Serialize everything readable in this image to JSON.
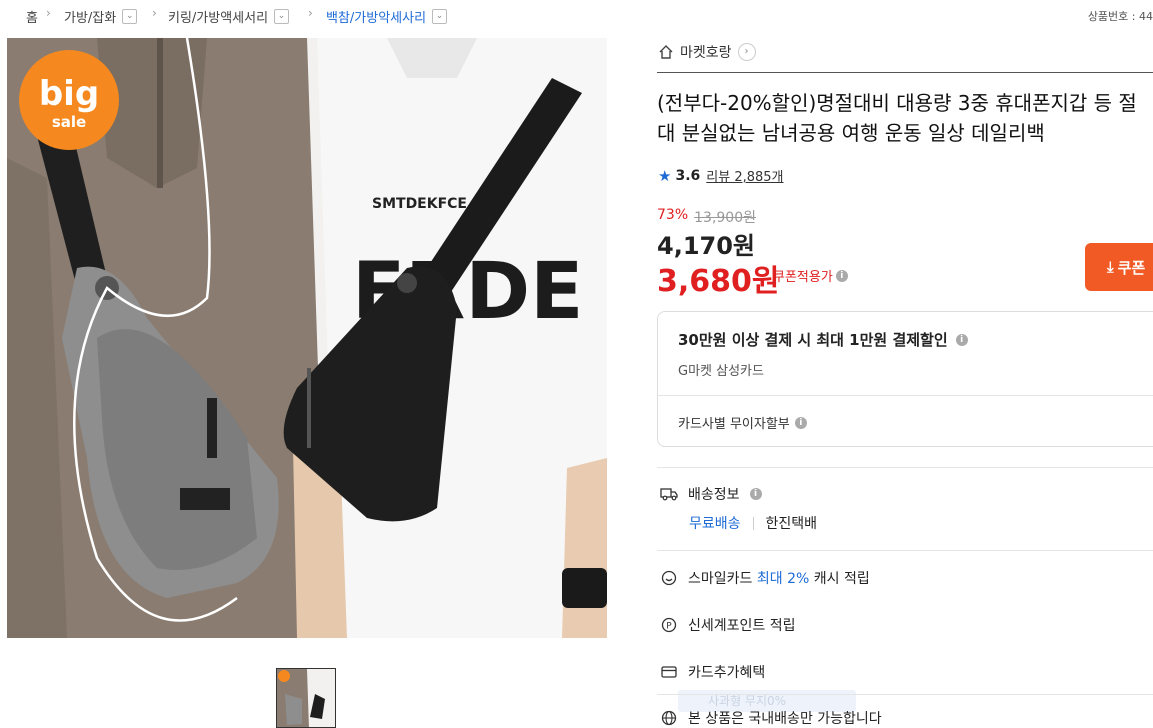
{
  "breadcrumb": {
    "home": "홈",
    "items": [
      "가방/잡화",
      "키링/가방액세서리",
      "백참/가방악세사리"
    ]
  },
  "product_no_label": "상품번호 : 44",
  "seller": {
    "name": "마켓호랑"
  },
  "badge": {
    "line1": "big",
    "line2": "sale"
  },
  "product": {
    "title": "(전부다-20%할인)명절대비 대용량 3중 휴대폰지갑 등 절대 분실없는 남녀공용 여행 운동 일상 데일리백",
    "rating": "3.6",
    "review_text": "리뷰 2,885개",
    "discount_rate": "73%",
    "original_price": "13,900원",
    "price": "4,170원",
    "coupon_price": "3,680원",
    "coupon_price_label": "쿠폰적용가"
  },
  "coupon_button": {
    "label": "쿠폰"
  },
  "card_benefit": {
    "headline": "30만원 이상 결제 시 최대 1만원 결제할인",
    "card_name": "G마켓 삼성카드",
    "installment": "카드사별 무이자할부"
  },
  "shipping": {
    "label": "배송정보",
    "free": "무료배송",
    "courier": "한진택배"
  },
  "smilecard": {
    "prefix": "스마일카드",
    "highlight": "최대 2%",
    "suffix": "캐시 적립"
  },
  "shinsegae": {
    "label": "신세계포인트 적립"
  },
  "card_extra": {
    "label": "카드추가혜택"
  },
  "domestic": {
    "label": "본 상품은 국내배송만 가능합니다"
  },
  "tooltip_text": "사과형 무지0%"
}
